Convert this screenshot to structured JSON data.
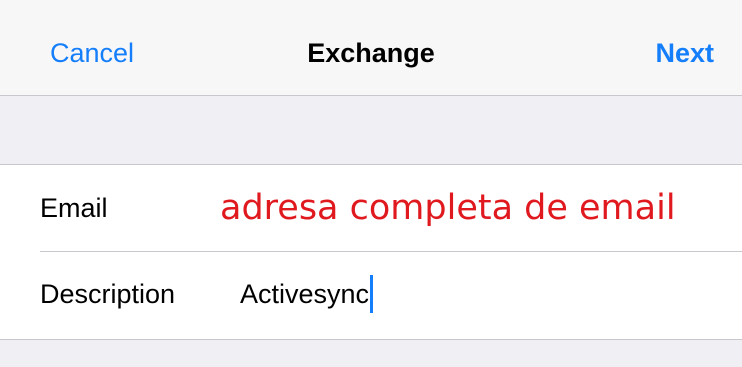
{
  "navbar": {
    "cancel_label": "Cancel",
    "title": "Exchange",
    "next_label": "Next"
  },
  "form": {
    "email": {
      "label": "Email",
      "value": "adresa completa de email",
      "value_color": "#e0191f"
    },
    "description": {
      "label": "Description",
      "value": "Activesync"
    }
  },
  "colors": {
    "accent": "#147efb",
    "background": "#efeff4",
    "separator": "#c8c7cc"
  }
}
